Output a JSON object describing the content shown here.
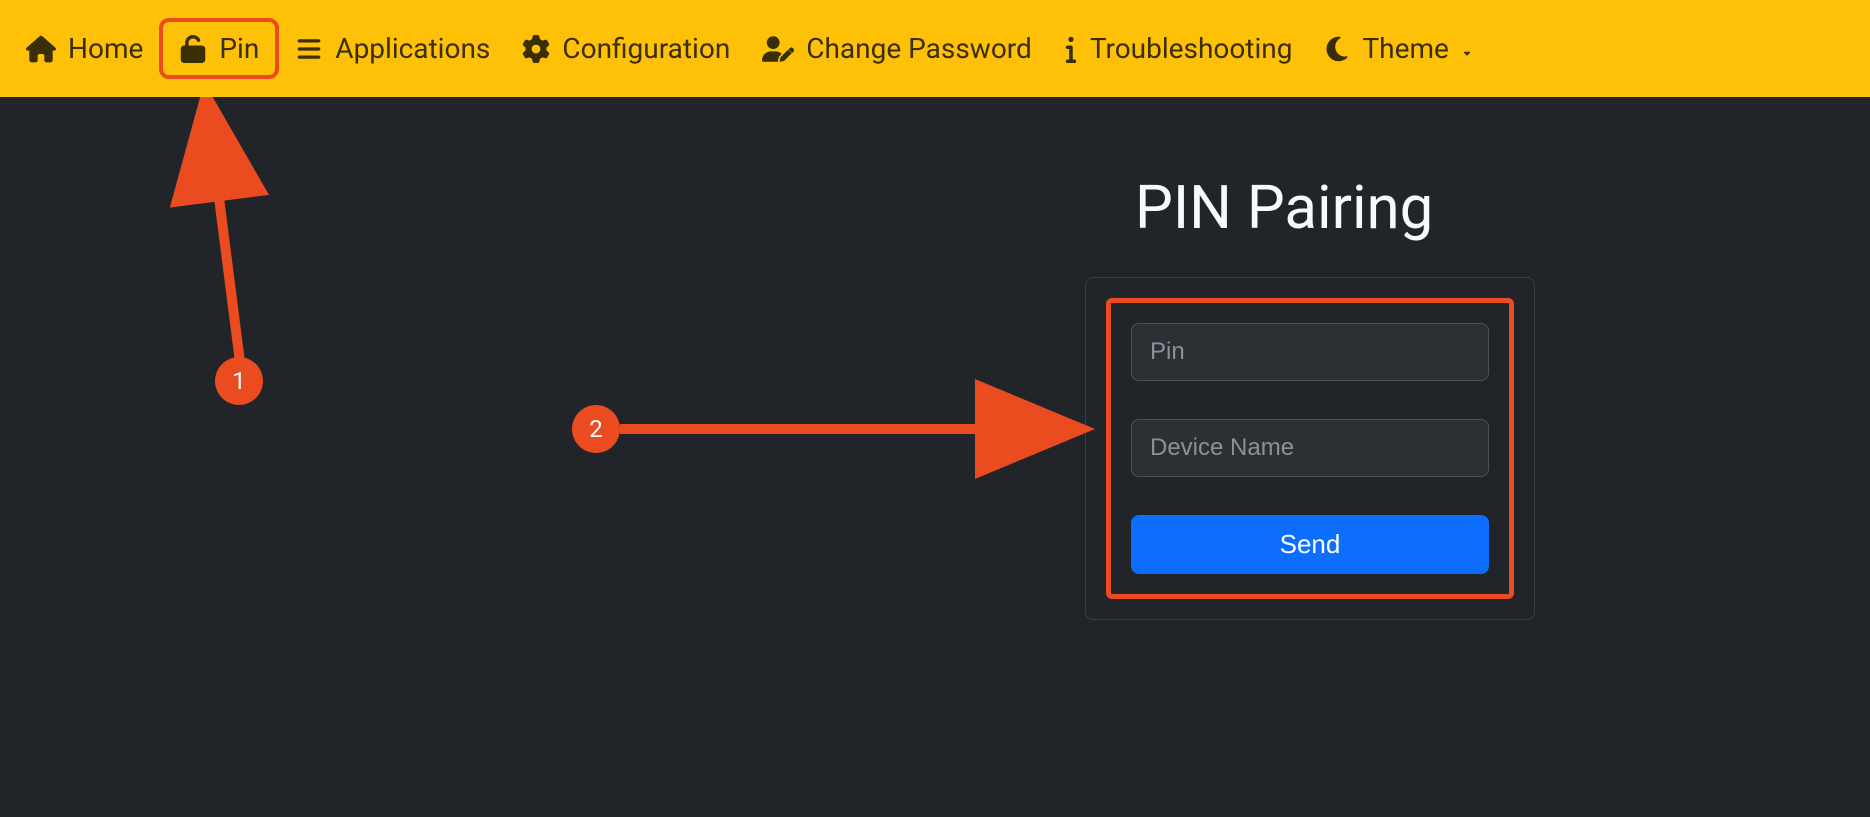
{
  "nav": {
    "home": "Home",
    "pin": "Pin",
    "applications": "Applications",
    "configuration": "Configuration",
    "change_password": "Change Password",
    "troubleshooting": "Troubleshooting",
    "theme": "Theme"
  },
  "page": {
    "title": "PIN Pairing"
  },
  "form": {
    "pin_placeholder": "Pin",
    "device_placeholder": "Device Name",
    "send_label": "Send"
  },
  "annotations": {
    "badge1": "1",
    "badge2": "2"
  }
}
